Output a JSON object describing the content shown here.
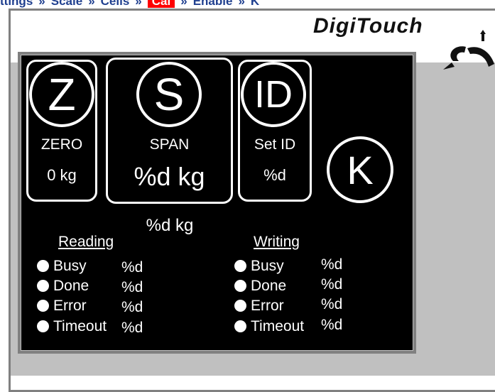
{
  "breadcrumb": {
    "items": [
      "ttings",
      "Scale",
      "Cells",
      "Cal",
      "Enable",
      "K"
    ],
    "active_index": 3,
    "separator": "»"
  },
  "brand": {
    "logo_text": "DigiTouch"
  },
  "buttons": {
    "zero": {
      "glyph": "Z",
      "label": "ZERO",
      "value": "0 kg"
    },
    "span": {
      "glyph": "S",
      "label": "SPAN",
      "value": "%d kg"
    },
    "set_id": {
      "glyph": "ID",
      "label": "Set ID",
      "value": "%d"
    },
    "k": {
      "glyph": "K"
    }
  },
  "weight_readout": "%d kg",
  "reading": {
    "title": "Reading",
    "rows": [
      {
        "label": "Busy",
        "value": "%d"
      },
      {
        "label": "Done",
        "value": "%d"
      },
      {
        "label": "Error",
        "value": "%d"
      },
      {
        "label": "Timeout",
        "value": "%d"
      }
    ]
  },
  "writing": {
    "title": "Writing",
    "rows": [
      {
        "label": "Busy",
        "value": "%d"
      },
      {
        "label": "Done",
        "value": "%d"
      },
      {
        "label": "Error",
        "value": "%d"
      },
      {
        "label": "Timeout",
        "value": "%d"
      }
    ]
  },
  "colors": {
    "panel_bg": "#000000",
    "foreground": "#ffffff",
    "frame": "#808080",
    "backdrop": "#c0c0c0",
    "breadcrumb_text": "#1f3f8f",
    "active_crumb": "#ff0000"
  },
  "icons": [
    "logo-mark-icon",
    "status-dot-icon"
  ]
}
